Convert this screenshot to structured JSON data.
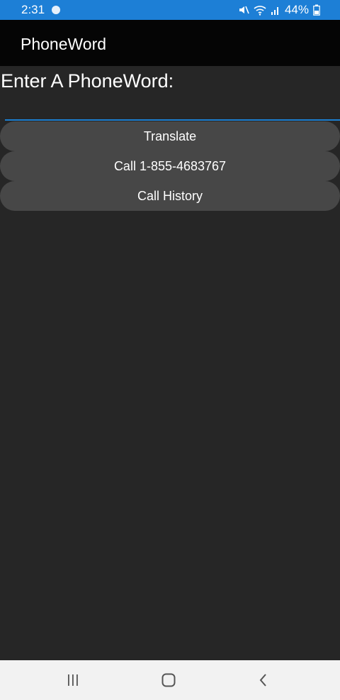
{
  "status_bar": {
    "time": "2:31",
    "battery_percent": "44%",
    "icons": [
      "app-notification-icon",
      "mute-icon",
      "wifi-icon",
      "signal-icon",
      "battery-icon"
    ],
    "background_color": "#1d7fd6"
  },
  "app_bar": {
    "title": "PhoneWord"
  },
  "form": {
    "prompt_label": "Enter A PhoneWord:",
    "input_value": "",
    "input_underline_color": "#1c7fd0"
  },
  "buttons": {
    "translate_label": "Translate",
    "call_label": "Call 1-855-4683767",
    "history_label": "Call History"
  },
  "nav_bar": {
    "icons": [
      "recent-apps-icon",
      "home-icon",
      "back-icon"
    ]
  }
}
